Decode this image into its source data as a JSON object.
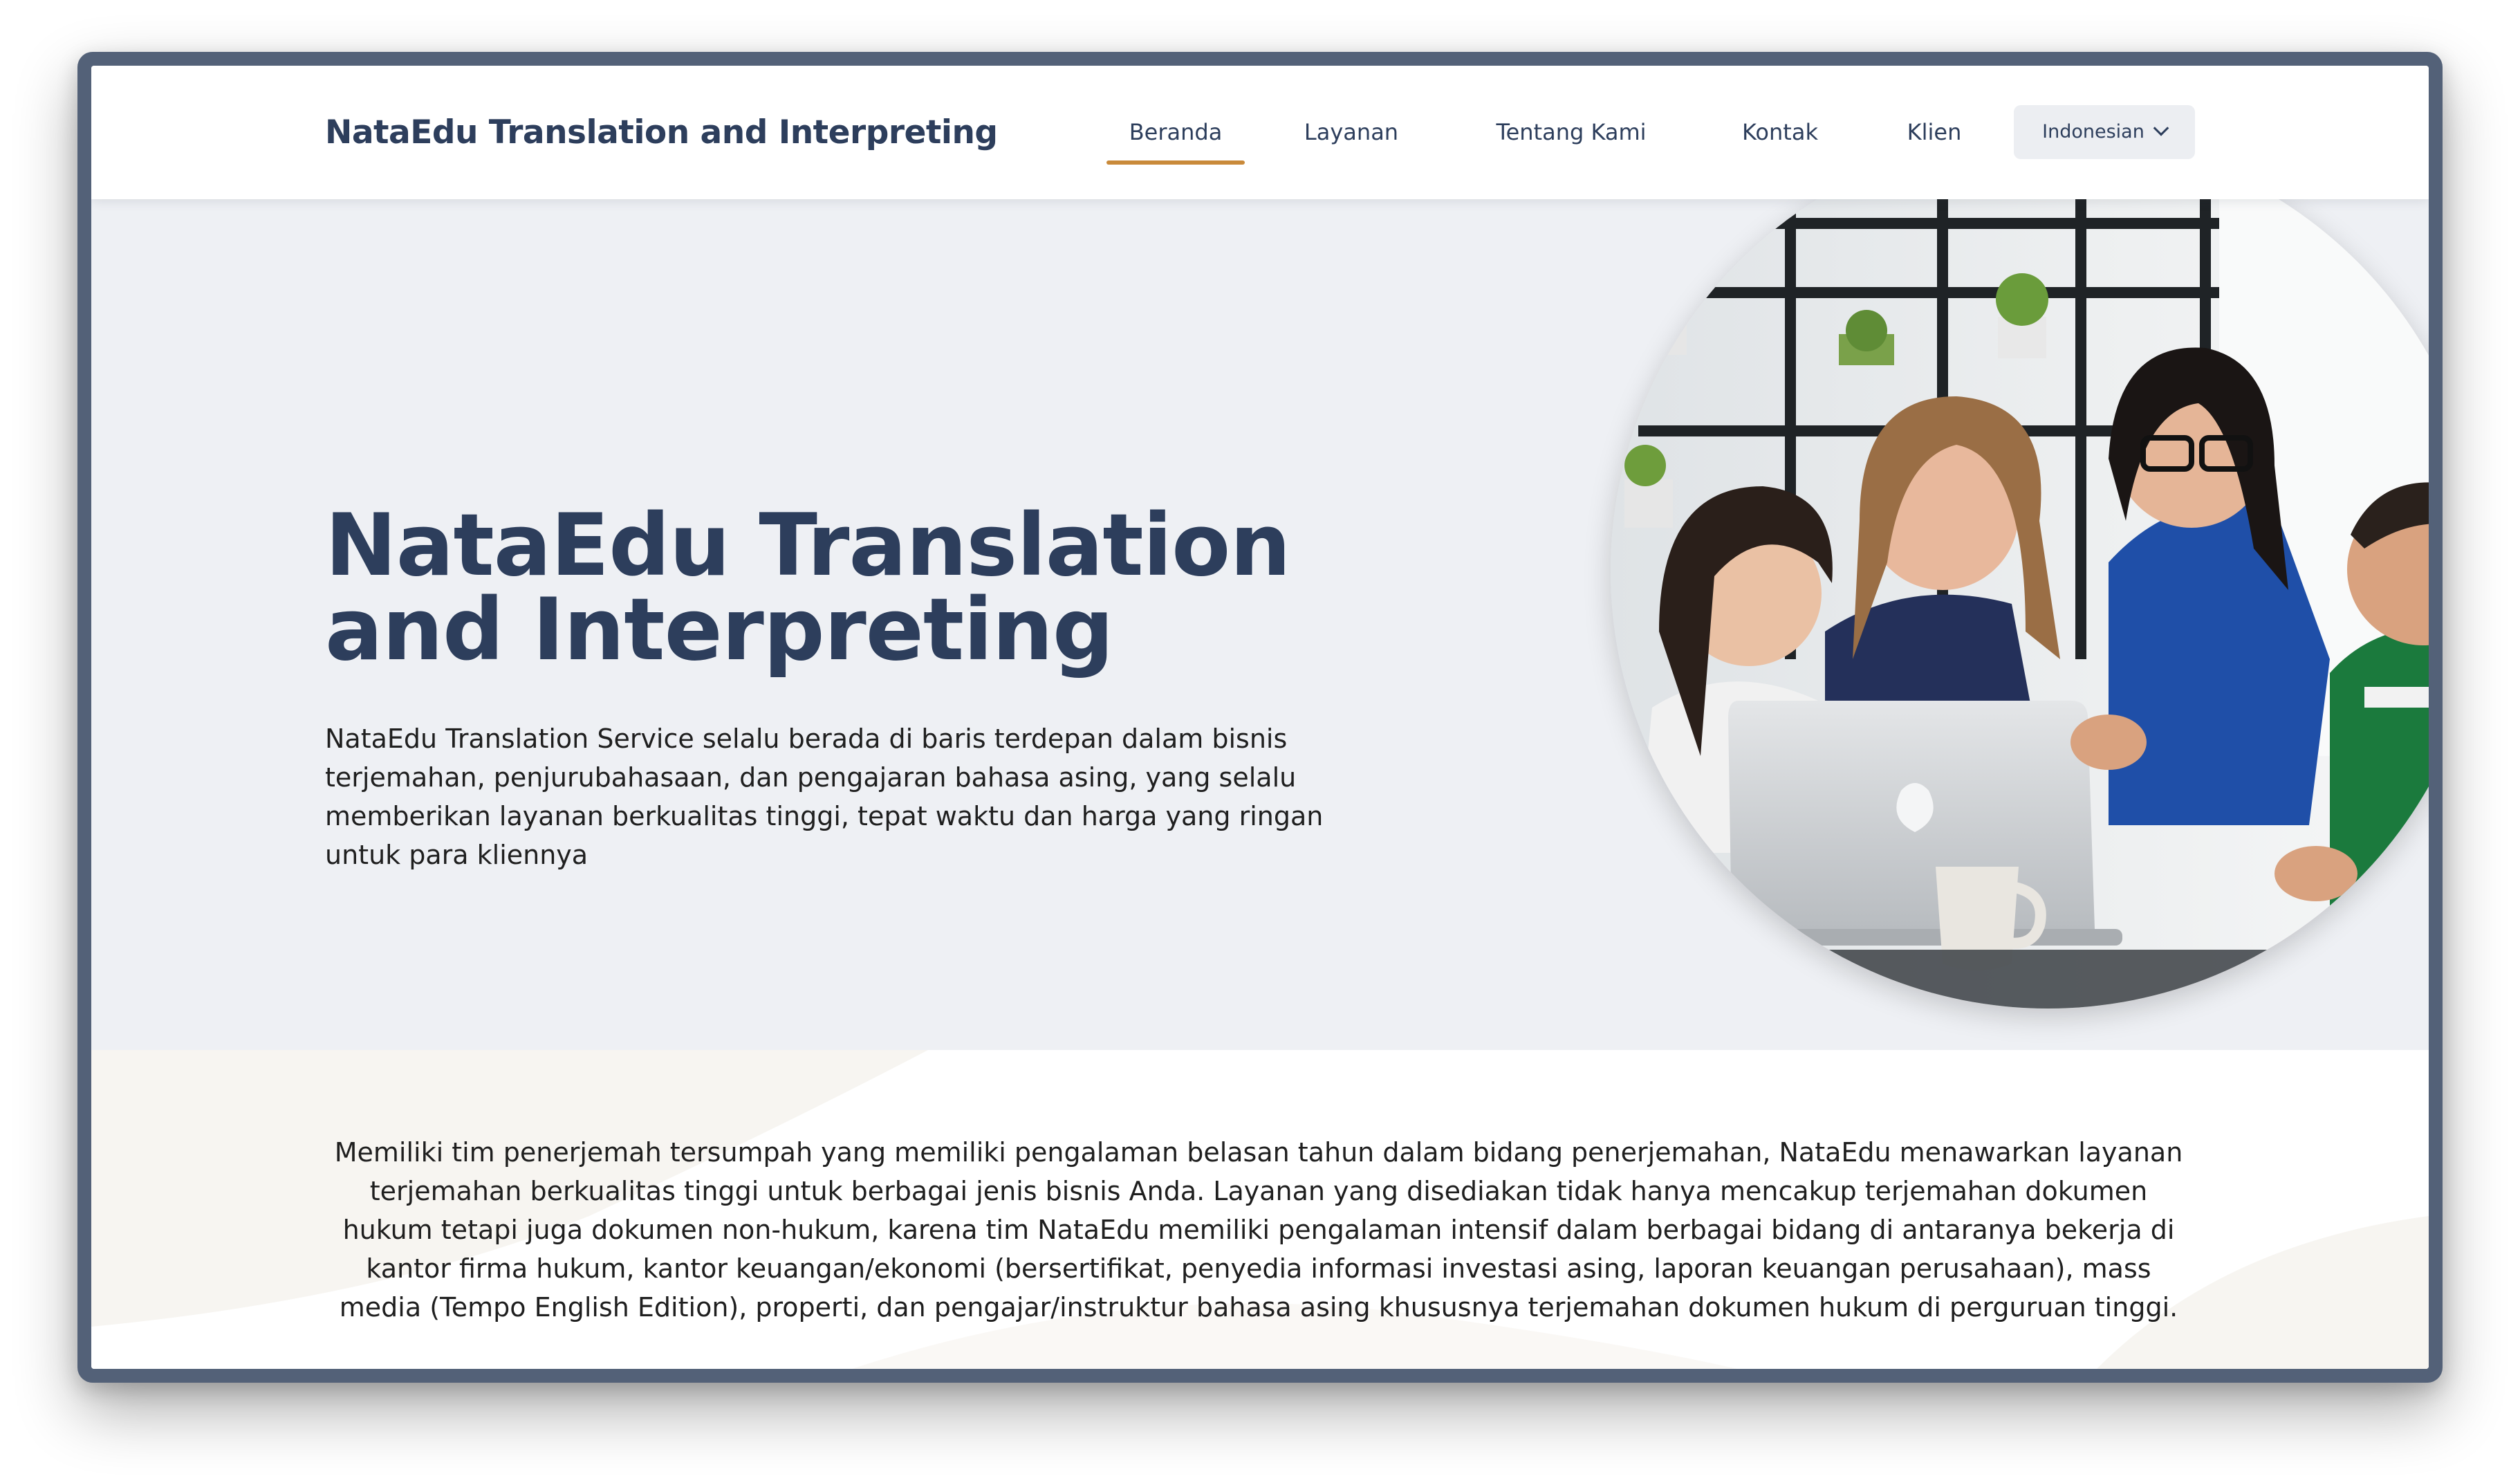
{
  "header": {
    "brand": "NataEdu Translation and Interpreting",
    "nav": [
      {
        "label": "Beranda",
        "active": true
      },
      {
        "label": "Layanan",
        "active": false
      },
      {
        "label": "Tentang Kami",
        "active": false
      },
      {
        "label": "Kontak",
        "active": false
      },
      {
        "label": "Klien",
        "active": false
      }
    ],
    "language": {
      "selected": "Indonesian",
      "icon": "chevron-down-icon"
    }
  },
  "hero": {
    "title_line1": "NataEdu Translation",
    "title_line2": "and Interpreting",
    "description": "NataEdu Translation Service selalu berada di baris terdepan dalam bisnis terjemahan, penjurubahasaan, dan pengajaran bahasa asing, yang selalu memberikan layanan berkualitas tinggi, tepat waktu dan harga yang ringan untuk para kliennya",
    "image": "team-laptop-photo"
  },
  "about": {
    "text": "Memiliki tim penerjemah tersumpah yang memiliki pengalaman belasan tahun dalam bidang penerjemahan, NataEdu menawarkan layanan terjemahan berkualitas tinggi untuk berbagai jenis bisnis Anda. Layanan yang disediakan tidak hanya mencakup terjemahan dokumen hukum tetapi juga dokumen non-hukum, karena tim NataEdu memiliki pengalaman intensif dalam berbagai bidang di antaranya bekerja di kantor firma hukum, kantor keuangan/ekonomi (bersertifikat, penyedia informasi investasi asing, laporan keuangan perusahaan), mass media (Tempo English Edition), properti, dan pengajar/instruktur bahasa asing khususnya terjemahan dokumen hukum di perguruan tinggi."
  },
  "colors": {
    "primary": "#2d3e5c",
    "accent": "#c98a3a",
    "hero_bg": "#eef0f4",
    "frame": "#536178"
  }
}
